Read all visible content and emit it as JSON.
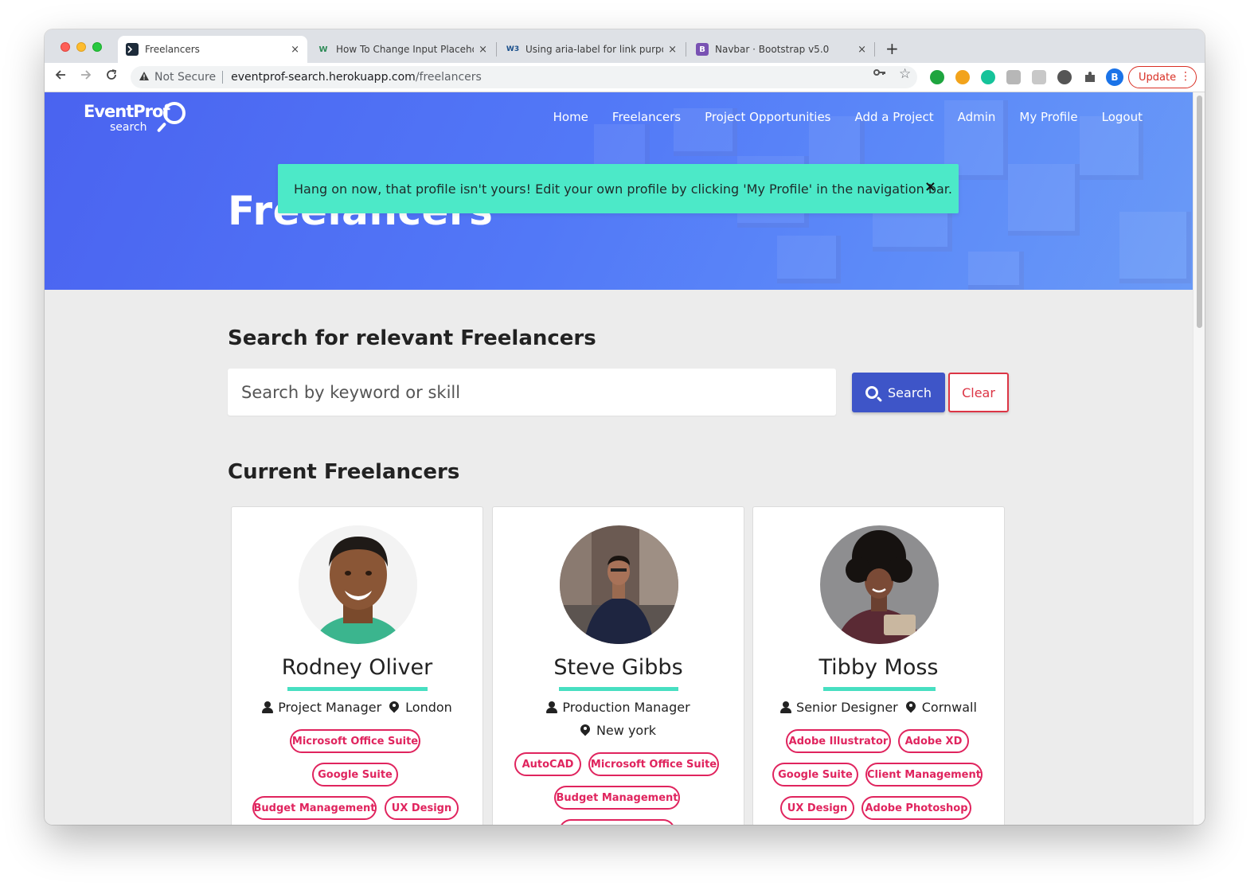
{
  "browser": {
    "tabs": [
      {
        "title": "Freelancers",
        "active": true,
        "favicon": "terminal-icon"
      },
      {
        "title": "How To Change Input Placehol",
        "active": false,
        "favicon": "w-icon"
      },
      {
        "title": "Using aria-label for link purpos",
        "active": false,
        "favicon": "w3-icon"
      },
      {
        "title": "Navbar · Bootstrap v5.0",
        "active": false,
        "favicon": "bootstrap-icon"
      }
    ],
    "favicon_text": {
      "w": "W",
      "w3": "W3",
      "bootstrap": "B"
    },
    "close_glyph": "×",
    "new_tab_glyph": "+",
    "security_label": "Not Secure",
    "url_host": "eventprof-search.herokuapp.com",
    "url_path": "/freelancers",
    "profile_initial": "B",
    "update_label": "Update"
  },
  "site": {
    "logo_brand": "EventProf",
    "logo_sub": "search",
    "nav": [
      "Home",
      "Freelancers",
      "Project Opportunities",
      "Add a Project",
      "Admin",
      "My Profile",
      "Logout"
    ],
    "hero_title": "Freelancers",
    "alert_message": "Hang on now, that profile isn't yours! Edit your own profile by clicking 'My Profile' in the navigation bar.",
    "alert_close": "×"
  },
  "search": {
    "heading": "Search for relevant Freelancers",
    "placeholder": "Search by keyword or skill",
    "search_label": "Search",
    "clear_label": "Clear"
  },
  "freelancers": {
    "heading": "Current Freelancers",
    "cards": [
      {
        "name": "Rodney Oliver",
        "role": "Project Manager",
        "location": "London",
        "skills": [
          "Microsoft Office Suite",
          "Google Suite",
          "Budget Management",
          "UX Design"
        ]
      },
      {
        "name": "Steve Gibbs",
        "role": "Production Manager",
        "location": "New york",
        "skills": [
          "AutoCAD",
          "Microsoft Office Suite",
          "Budget Management"
        ]
      },
      {
        "name": "Tibby Moss",
        "role": "Senior Designer",
        "location": "Cornwall",
        "skills": [
          "Adobe Illustrator",
          "Adobe XD",
          "Google Suite",
          "Client Management",
          "UX Design",
          "Adobe Photoshop"
        ]
      }
    ]
  },
  "colors": {
    "hero_blue": "#4a63f0",
    "alert_teal": "#4ce9c8",
    "search_button": "#3e55c8",
    "danger": "#dc3545",
    "skill_pink": "#e0245e",
    "underline_teal": "#47dfc1"
  }
}
